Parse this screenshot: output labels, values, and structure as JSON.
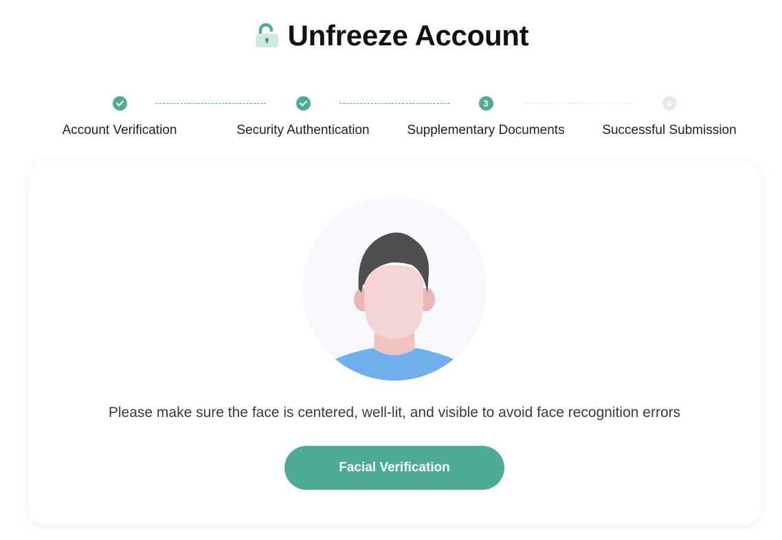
{
  "header": {
    "title": "Unfreeze Account",
    "icon": "unlocked-padlock-icon"
  },
  "stepper": {
    "steps": [
      {
        "label": "Account Verification",
        "status": "completed",
        "marker": ""
      },
      {
        "label": "Security Authentication",
        "status": "completed",
        "marker": ""
      },
      {
        "label": "Supplementary Documents",
        "status": "current",
        "marker": "3"
      },
      {
        "label": "Successful Submission",
        "status": "pending",
        "marker": "4"
      }
    ]
  },
  "main": {
    "illustration": "face-avatar-icon",
    "hint": "Please make sure the face is centered, well-lit, and visible to avoid face recognition errors",
    "button_label": "Facial Verification"
  },
  "colors": {
    "accent": "#4eab96",
    "pending": "#e6e8eb",
    "avatar_background": "#f6f8fc",
    "hair": "#4f4f4f",
    "skin": "#f4d4d4",
    "shirt": "#6fb0ec"
  }
}
